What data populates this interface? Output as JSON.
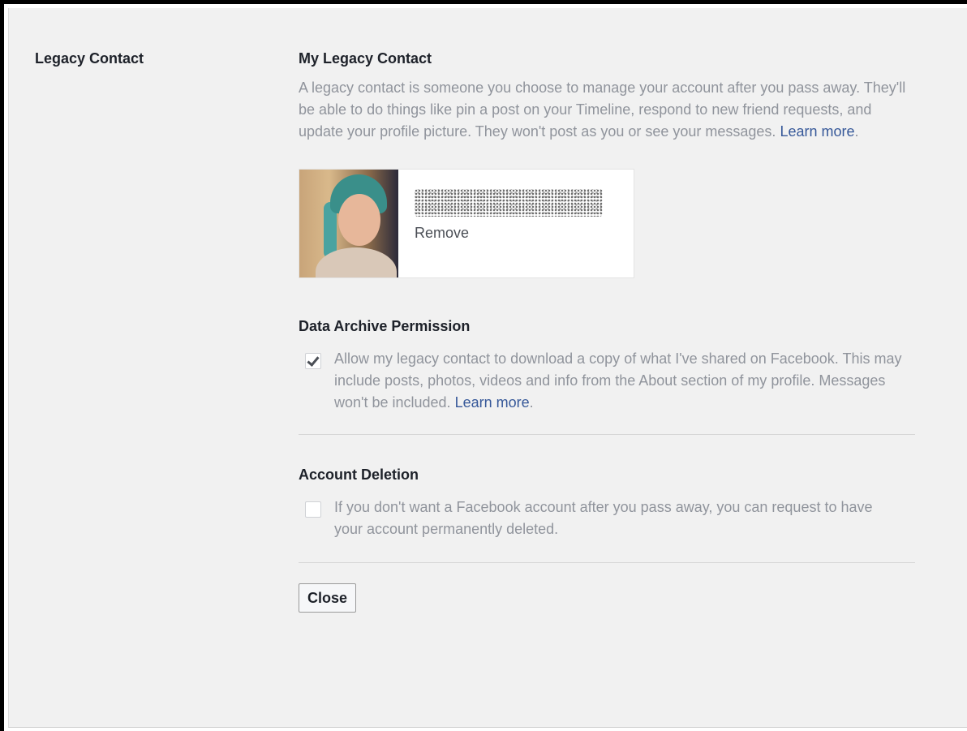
{
  "section_label": "Legacy Contact",
  "legacy": {
    "heading": "My Legacy Contact",
    "description": "A legacy contact is someone you choose to manage your account after you pass away. They'll be able to do things like pin a post on your Timeline, respond to new friend requests, and update your profile picture. They won't post as you or see your messages.",
    "learn_more": "Learn more",
    "after_link": "."
  },
  "contact_card": {
    "remove_label": "Remove"
  },
  "archive": {
    "heading": "Data Archive Permission",
    "checked": true,
    "text": "Allow my legacy contact to download a copy of what I've shared on Facebook. This may include posts, photos, videos and info from the About section of my profile. Messages won't be included.",
    "learn_more": "Learn more",
    "after_link": "."
  },
  "deletion": {
    "heading": "Account Deletion",
    "checked": false,
    "text": "If you don't want a Facebook account after you pass away, you can request to have your account permanently deleted."
  },
  "close_label": "Close",
  "colors": {
    "link": "#365899",
    "muted_text": "#90949c",
    "panel_bg": "#f1f1f1"
  }
}
